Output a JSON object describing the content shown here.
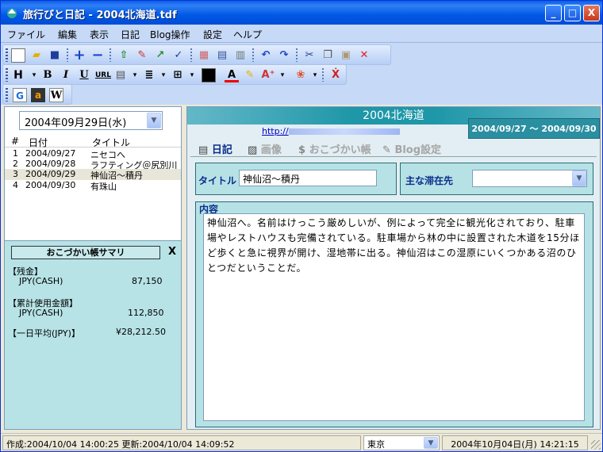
{
  "window": {
    "title": "旅行びと日記 - 2004北海道.tdf",
    "buttons": {
      "min": "_",
      "max": "□",
      "close": "X"
    }
  },
  "menu": [
    "ファイル",
    "編集",
    "表示",
    "日記",
    "Blog操作",
    "設定",
    "ヘルプ"
  ],
  "toolbar2": {
    "bold": "B",
    "italic": "I",
    "underline": "U",
    "url": "URL"
  },
  "toolbar3": {
    "google": "G",
    "amazon": "a",
    "wiki": "W"
  },
  "left": {
    "date": "2004年09月29日(水)",
    "headers": {
      "num": "#",
      "date": "日付",
      "title": "タイトル"
    },
    "entries": [
      {
        "num": "1",
        "date": "2004/09/27",
        "title": "ニセコへ"
      },
      {
        "num": "2",
        "date": "2004/09/28",
        "title": "ラフティング＠尻別川"
      },
      {
        "num": "3",
        "date": "2004/09/29",
        "title": "神仙沼〜積丹"
      },
      {
        "num": "4",
        "date": "2004/09/30",
        "title": "有珠山"
      }
    ],
    "summary": {
      "title": "おこづかい帳サマリ",
      "close": "X",
      "zan_label": "【残金】",
      "zan_item": "JPY(CASH)",
      "zan_value": "87,150",
      "used_label": "【累計使用金額】",
      "used_item": "JPY(CASH)",
      "used_value": "112,850",
      "avg_label": "【一日平均(JPY)】",
      "avg_value": "¥28,212.50"
    }
  },
  "right": {
    "diary_name": "2004北海道",
    "url": "http://",
    "period": "2004/09/27 〜 2004/09/30",
    "tabs": [
      "日記",
      "画像",
      "おこづかい帳",
      "Blog設定"
    ],
    "title_label": "タイトル",
    "title_value": "神仙沼〜積丹",
    "place_label": "主な滞在先",
    "place_value": "",
    "content_label": "内容",
    "content": "神仙沼へ。名前はけっこう厳めしいが、例によって完全に観光化されており、駐車場やレストハウスも完備されている。駐車場から林の中に設置された木道を15分ほど歩くと急に視界が開け、湿地帯に出る。神仙沼はこの湿原にいくつかある沼のひとつだということだ。"
  },
  "status": {
    "created": "作成:2004/10/04 14:00:25 更新:2004/10/04 14:09:52",
    "city": "東京",
    "now": "2004年10月04日(月) 14:21:15"
  },
  "colors": {
    "accent": "#1e97a8",
    "title_bar": "#0058e6",
    "summary_bg": "#b7e3e6"
  }
}
